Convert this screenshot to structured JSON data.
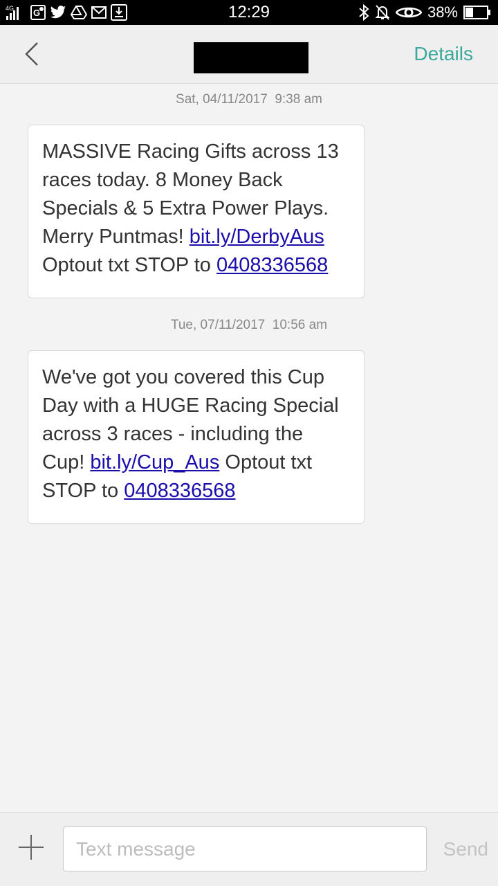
{
  "status_bar": {
    "network": "4G",
    "time": "12:29",
    "battery_percent": "38%",
    "battery_level": 0.38,
    "left_icons": [
      "signal-icon",
      "maps-icon",
      "twitter-icon",
      "drive-icon",
      "gmail-icon",
      "download-icon"
    ],
    "right_icons": [
      "bluetooth-icon",
      "notifications-off-icon",
      "eye-icon",
      "battery-icon"
    ]
  },
  "header": {
    "details_label": "Details",
    "contact_name": "",
    "back_icon": "chevron-left-icon"
  },
  "conversation": {
    "messages": [
      {
        "timestamp": "Sat, 04/11/2017  9:38 am",
        "text_1": "MASSIVE Racing Gifts across 13 races today. 8 Money Back Specials & 5 Extra Power Plays. Merry Puntmas! ",
        "link": "bit.ly/DerbyAus",
        "text_2": " Optout txt STOP to ",
        "phone": "0408336568"
      },
      {
        "timestamp": "Tue, 07/11/2017  10:56 am",
        "text_1": "We've got you covered this Cup Day with a HUGE Racing Special across 3 races - including the Cup! ",
        "link": "bit.ly/Cup_Aus",
        "text_2": " Optout txt STOP to ",
        "phone": "0408336568"
      }
    ]
  },
  "input_bar": {
    "placeholder": "Text message",
    "value": "",
    "send_label": "Send",
    "attach_icon": "plus-icon"
  },
  "colors": {
    "accent": "#3aa89a",
    "link": "#1a0dab",
    "background": "#f3f3f3",
    "bubble": "#ffffff"
  }
}
